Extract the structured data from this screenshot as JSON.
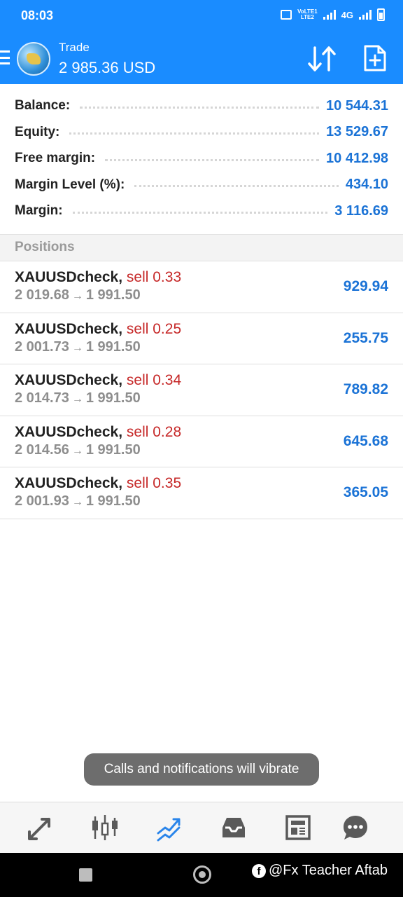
{
  "status_bar": {
    "time": "08:03",
    "volte_line1": "VoLTE1",
    "volte_line2": "LTE2",
    "network": "4G"
  },
  "header": {
    "title": "Trade",
    "value": "2 985.36 USD",
    "icons": [
      "menu-icon",
      "app-logo",
      "sort-icon",
      "new-order-icon"
    ]
  },
  "summary": [
    {
      "label": "Balance:",
      "value": "10 544.31"
    },
    {
      "label": "Equity:",
      "value": "13 529.67"
    },
    {
      "label": "Free margin:",
      "value": "10 412.98"
    },
    {
      "label": "Margin Level (%):",
      "value": "434.10"
    },
    {
      "label": "Margin:",
      "value": "3 116.69"
    }
  ],
  "positions_header": "Positions",
  "positions": [
    {
      "symbol": "XAUUSDcheck,",
      "side": "sell 0.33",
      "open": "2 019.68",
      "arrow": "→",
      "current": "1 991.50",
      "profit": "929.94"
    },
    {
      "symbol": "XAUUSDcheck,",
      "side": "sell 0.25",
      "open": "2 001.73",
      "arrow": "→",
      "current": "1 991.50",
      "profit": "255.75"
    },
    {
      "symbol": "XAUUSDcheck,",
      "side": "sell 0.34",
      "open": "2 014.73",
      "arrow": "→",
      "current": "1 991.50",
      "profit": "789.82"
    },
    {
      "symbol": "XAUUSDcheck,",
      "side": "sell 0.28",
      "open": "2 014.56",
      "arrow": "→",
      "current": "1 991.50",
      "profit": "645.68"
    },
    {
      "symbol": "XAUUSDcheck,",
      "side": "sell 0.35",
      "open": "2 001.93",
      "arrow": "→",
      "current": "1 991.50",
      "profit": "365.05"
    }
  ],
  "toast": "Calls and notifications will vibrate",
  "bottom_nav": [
    "quotes-icon",
    "chart-icon",
    "trade-icon",
    "history-icon",
    "news-icon",
    "chat-icon"
  ],
  "watermark": {
    "fb_glyph": "f",
    "text": "@Fx Teacher Aftab"
  },
  "colors": {
    "accent": "#1a8cff",
    "profit": "#1b73d6",
    "sell": "#c62828"
  }
}
